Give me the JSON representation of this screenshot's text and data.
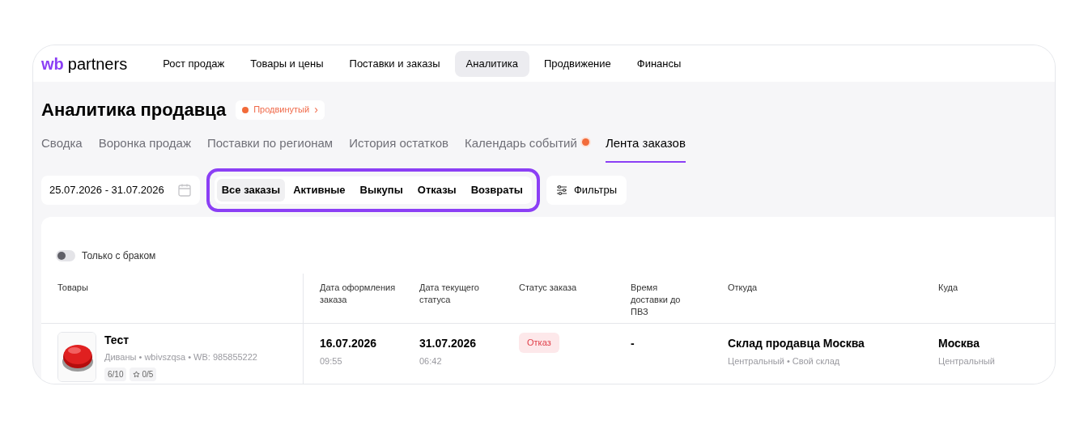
{
  "logo": {
    "brand": "wb",
    "name": "partners"
  },
  "nav": [
    {
      "label": "Рост продаж",
      "selected": false
    },
    {
      "label": "Товары и цены",
      "selected": false
    },
    {
      "label": "Поставки и заказы",
      "selected": false
    },
    {
      "label": "Аналитика",
      "selected": true
    },
    {
      "label": "Продвижение",
      "selected": false
    },
    {
      "label": "Финансы",
      "selected": false
    }
  ],
  "page_title": "Аналитика продавца",
  "plan_badge": {
    "label": "Продвинутый",
    "chevron": "›"
  },
  "subtabs": [
    {
      "label": "Сводка",
      "selected": false,
      "dot": false
    },
    {
      "label": "Воронка продаж",
      "selected": false,
      "dot": false
    },
    {
      "label": "Поставки по регионам",
      "selected": false,
      "dot": false
    },
    {
      "label": "История остатков",
      "selected": false,
      "dot": false
    },
    {
      "label": "Календарь событий",
      "selected": false,
      "dot": true
    },
    {
      "label": "Лента заказов",
      "selected": true,
      "dot": false
    }
  ],
  "date_range": "25.07.2026 - 31.07.2026",
  "segments": [
    {
      "label": "Все заказы",
      "selected": true
    },
    {
      "label": "Активные",
      "selected": false
    },
    {
      "label": "Выкупы",
      "selected": false
    },
    {
      "label": "Отказы",
      "selected": false
    },
    {
      "label": "Возвраты",
      "selected": false
    }
  ],
  "filters_button": "Фильтры",
  "defect_toggle": {
    "label": "Только с браком",
    "on": false
  },
  "table": {
    "columns": [
      "Товары",
      "Дата оформления заказа",
      "Дата текущего статуса",
      "Статус заказа",
      "Время доставки до ПВЗ",
      "Откуда",
      "Куда"
    ],
    "rows": [
      {
        "product": {
          "kind": "picture",
          "name": "Тест",
          "meta": "Диваны • wbivszqsa • WB: 985855222",
          "rating": "6/10",
          "stars_text": "0/5"
        },
        "order_date": "16.07.2026",
        "order_time": "09:55",
        "status_date": "31.07.2026",
        "status_time": "06:42",
        "status": "Отказ",
        "delivery_time": "-",
        "from": "Склад продавца Москва",
        "from_sub": "Центральный • Свой склад",
        "to": "Москва",
        "to_sub": "Центральный"
      }
    ]
  }
}
